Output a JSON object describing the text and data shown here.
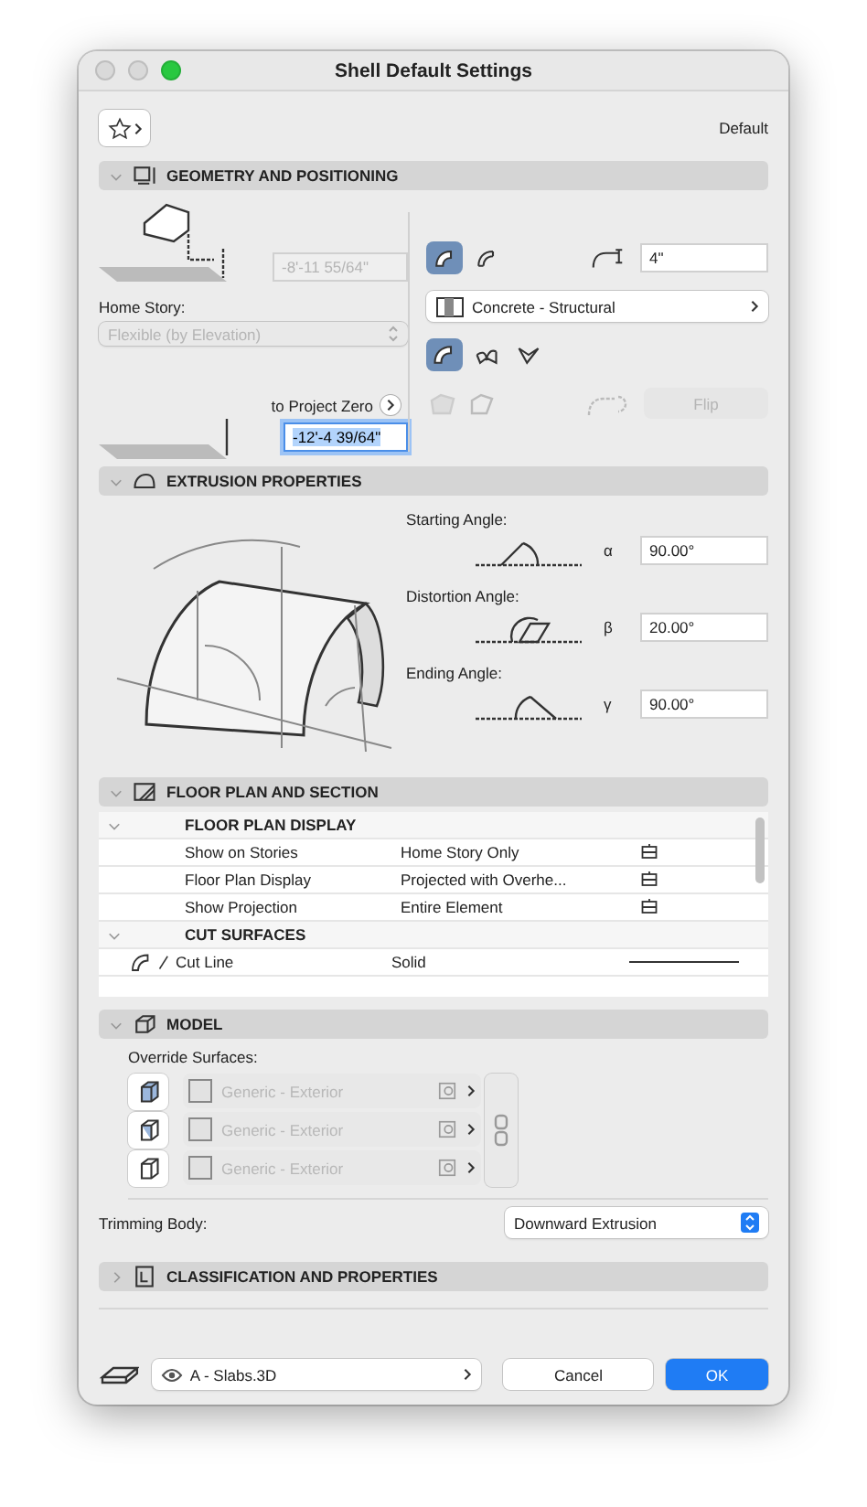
{
  "window": {
    "title": "Shell Default Settings"
  },
  "toolbar": {
    "preset_label": "Default"
  },
  "geometry": {
    "title": "GEOMETRY AND POSITIONING",
    "expanded": true,
    "top_offset": "-8'-11 55/64\"",
    "home_story_label": "Home Story:",
    "home_story": "Flexible (by Elevation)",
    "reference_label": "to Project Zero",
    "elevation": "-12'-4 39/64\"",
    "thickness": "4\"",
    "material": "Concrete - Structural",
    "flip_label": "Flip",
    "flip_disabled": true,
    "structure_options": [
      {
        "selected": true
      },
      {
        "selected": false
      }
    ],
    "shell_types": [
      {
        "selected": true
      },
      {
        "selected": false
      },
      {
        "selected": false
      }
    ]
  },
  "extrusion": {
    "title": "EXTRUSION PROPERTIES",
    "expanded": true,
    "angles": [
      {
        "label": "Starting Angle:",
        "symbol": "α",
        "value": "90.00°"
      },
      {
        "label": "Distortion Angle:",
        "symbol": "β",
        "value": "20.00°"
      },
      {
        "label": "Ending Angle:",
        "symbol": "γ",
        "value": "90.00°"
      }
    ]
  },
  "floor_plan": {
    "title": "FLOOR PLAN AND SECTION",
    "expanded": true,
    "groups": [
      {
        "title": "FLOOR PLAN DISPLAY",
        "expanded": true,
        "rows": [
          {
            "name": "Show on Stories",
            "value": "Home Story Only"
          },
          {
            "name": "Floor Plan Display",
            "value": "Projected with Overhe..."
          },
          {
            "name": "Show Projection",
            "value": "Entire Element"
          }
        ]
      },
      {
        "title": "CUT SURFACES",
        "expanded": true,
        "rows": [
          {
            "name": "Cut Line",
            "value": "Solid"
          }
        ]
      }
    ]
  },
  "model": {
    "title": "MODEL",
    "expanded": true,
    "override_label": "Override Surfaces:",
    "surfaces": [
      {
        "name": "Generic - Exterior",
        "disabled": true
      },
      {
        "name": "Generic - Exterior",
        "disabled": true
      },
      {
        "name": "Generic - Exterior",
        "disabled": true
      }
    ],
    "trimming_label": "Trimming Body:",
    "trimming_value": "Downward Extrusion"
  },
  "classification": {
    "title": "CLASSIFICATION AND PROPERTIES",
    "expanded": false
  },
  "footer": {
    "layer": "A - Slabs.3D",
    "cancel": "Cancel",
    "ok": "OK"
  }
}
